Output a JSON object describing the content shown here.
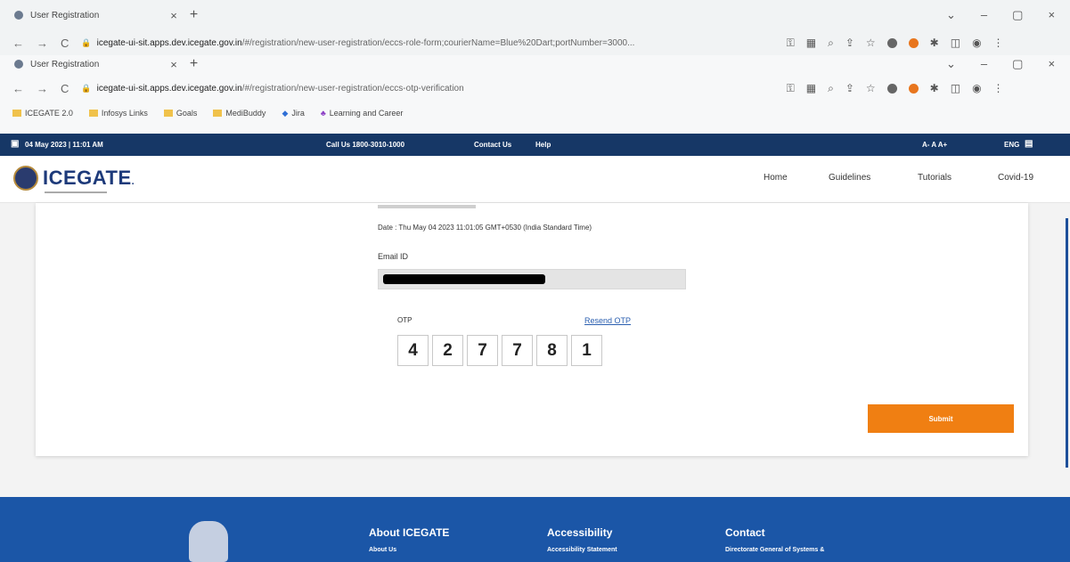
{
  "browser": {
    "tab1_title": "User Registration",
    "tab1_url_host": "icegate-ui-sit.apps.dev.icegate.gov.in",
    "tab1_url_path": "/#/registration/new-user-registration/eccs-role-form;courierName=Blue%20Dart;portNumber=3000...",
    "tab2_title": "User Registration",
    "tab2_url_host": "icegate-ui-sit.apps.dev.icegate.gov.in",
    "tab2_url_path": "/#/registration/new-user-registration/eccs-otp-verification",
    "bookmarks": [
      "ICEGATE 2.0",
      "Infosys Links",
      "Goals",
      "MediBuddy",
      "Jira",
      "Learning and Career"
    ]
  },
  "topbar": {
    "datetime": "04 May 2023 | 11:01 AM",
    "call_us": "Call Us  1800-3010-1000",
    "contact_us": "Contact Us",
    "help": "Help",
    "font_sizes": "A-  A  A+",
    "language": "ENG"
  },
  "header": {
    "logo": "ICEGATE",
    "logo_suffix": ".",
    "menu": [
      "Home",
      "Guidelines",
      "Tutorials",
      "Covid-19"
    ]
  },
  "form": {
    "date_text": "Date : Thu May 04 2023 11:01:05 GMT+0530 (India Standard Time)",
    "email_label": "Email ID",
    "otp_label": "OTP",
    "resend_label": "Resend OTP",
    "otp_digits": [
      "4",
      "2",
      "7",
      "7",
      "8",
      "1"
    ],
    "submit_label": "Submit"
  },
  "footer": {
    "about_heading": "About ICEGATE",
    "about_link": "About Us",
    "accessibility_heading": "Accessibility",
    "accessibility_link": "Accessibility Statement",
    "contact_heading": "Contact",
    "contact_text": "Directorate General of Systems &"
  }
}
